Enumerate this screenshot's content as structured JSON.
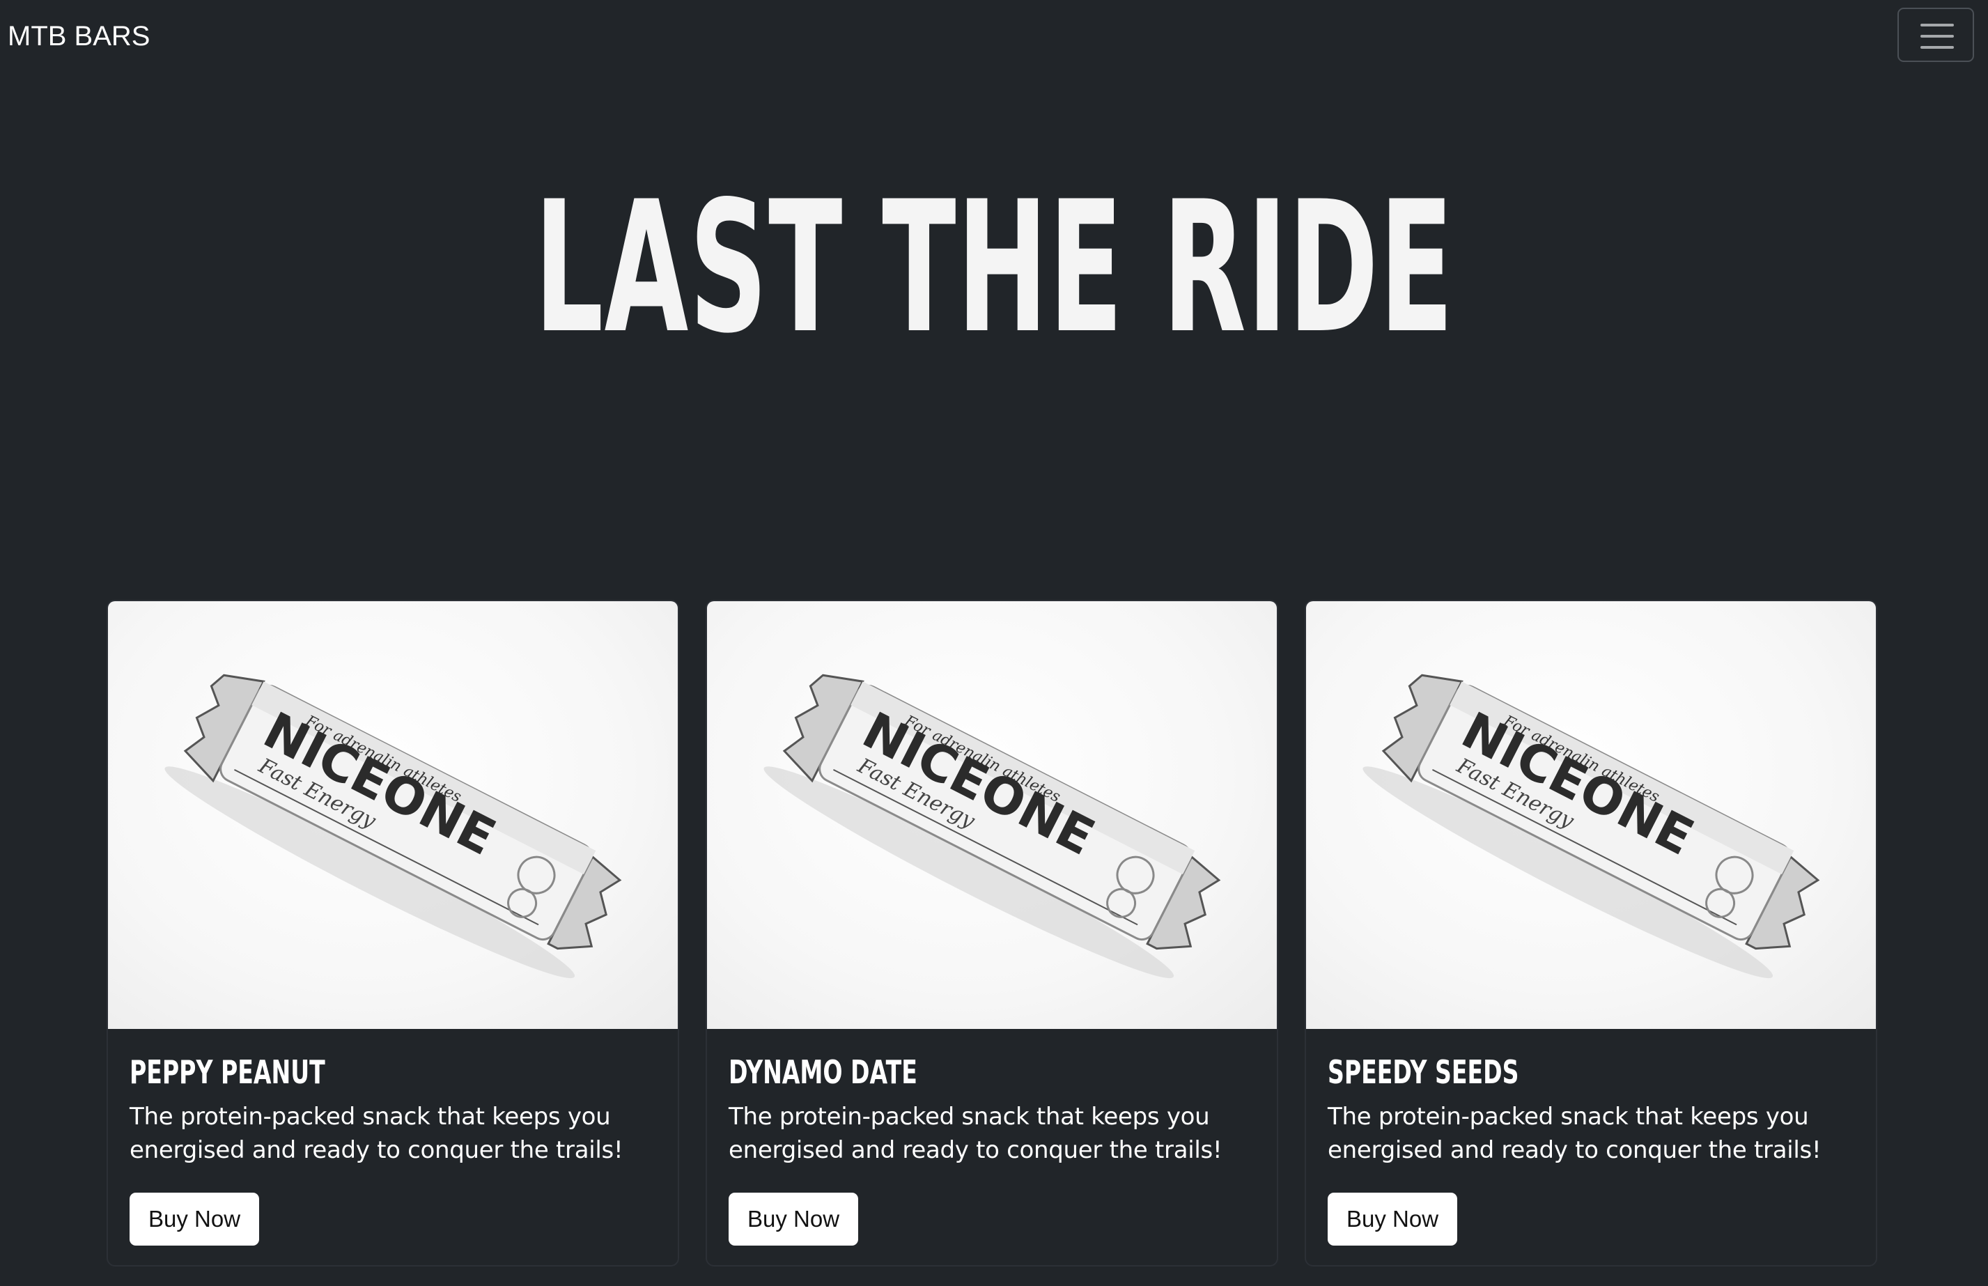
{
  "navbar": {
    "brand": "MTB BARS",
    "menu_icon": "hamburger-menu-icon"
  },
  "hero": {
    "title": "LAST THE RIDE"
  },
  "products": [
    {
      "name": "PEPPY PEANUT",
      "description": "The protein-packed snack that keeps you energised and ready to conquer the trails!",
      "button": "Buy Now",
      "image_brand": "NICEONE",
      "image_tagline": "For adrenalin athletes",
      "image_subtitle": "Fast Energy"
    },
    {
      "name": "DYNAMO DATE",
      "description": "The protein-packed snack that keeps you energised and ready to conquer the trails!",
      "button": "Buy Now",
      "image_brand": "NICEONE",
      "image_tagline": "For adrenalin athletes",
      "image_subtitle": "Fast Energy"
    },
    {
      "name": "SPEEDY SEEDS",
      "description": "The protein-packed snack that keeps you energised and ready to conquer the trails!",
      "button": "Buy Now",
      "image_brand": "NICEONE",
      "image_tagline": "For adrenalin athletes",
      "image_subtitle": "Fast Energy"
    }
  ],
  "colors": {
    "background": "#212529",
    "card_border": "#2c3036",
    "text": "#ffffff",
    "button_bg": "#ffffff"
  }
}
